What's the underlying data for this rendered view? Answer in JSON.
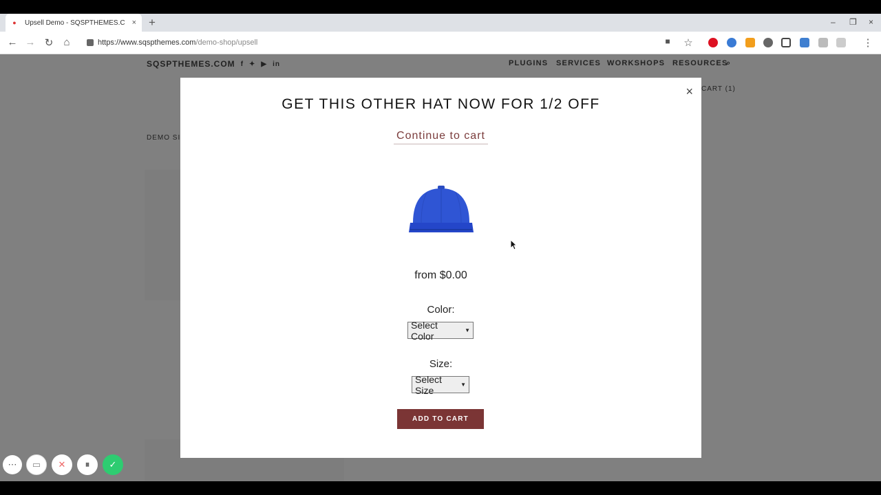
{
  "browser": {
    "tab_title": "Upsell Demo - SQSPTHEMES.CO",
    "tab_close": "×",
    "new_tab": "+",
    "url_host": "https://www.sqspthemes.com",
    "url_path": "/demo-shop/upsell",
    "window_controls": [
      "–",
      "❐",
      "×"
    ]
  },
  "site": {
    "brand": "SQSPTHEMES.COM",
    "social_icons": [
      "facebook-icon",
      "twitter-icon",
      "youtube-icon",
      "linkedin-icon"
    ],
    "nav": [
      "PLUGINS",
      "SERVICES",
      "WORKSHOPS",
      "RESOURCES"
    ],
    "cart": "CART (1)",
    "breadcrumb": "DEMO SI"
  },
  "modal": {
    "title": "GET THIS OTHER HAT NOW FOR 1/2 OFF",
    "continue_link": "Continue to cart",
    "close": "×",
    "price": "from $0.00",
    "color_label": "Color:",
    "color_select": "Select Color",
    "size_label": "Size:",
    "size_select": "Select Size",
    "add_to_cart": "ADD TO CART",
    "hat_color": "#2f55d4"
  },
  "recorder": {
    "buttons": [
      "more-icon",
      "camera-icon",
      "cancel-icon",
      "pause-icon",
      "confirm-icon"
    ]
  }
}
